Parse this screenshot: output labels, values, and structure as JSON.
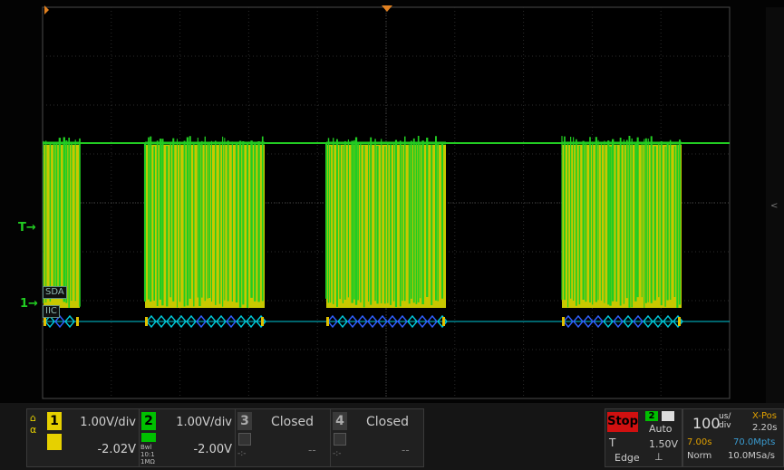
{
  "scope": {
    "markers": {
      "trigger_level_label": "T",
      "channel1_ground_label": "1"
    },
    "decode_labels": {
      "sda": "SDA",
      "protocol": "IIC"
    },
    "colors": {
      "ch1": "#c8c800",
      "ch2": "#22cc22",
      "decode": "#00c8d8",
      "grid": "#2b2b2b",
      "trigger": "#e08020"
    }
  },
  "channels": [
    {
      "number": "1",
      "scale": "1.00V/div",
      "offset": "-2.02V",
      "color": "#e6d000"
    },
    {
      "number": "2",
      "scale": "1.00V/div",
      "offset": "-2.00V",
      "color": "#00d000",
      "info": [
        "Bwl",
        "10:1",
        "1MΩ"
      ]
    },
    {
      "number": "3",
      "status": "Closed",
      "offset": "--",
      "sub": "-:-"
    },
    {
      "number": "4",
      "status": "Closed",
      "offset": "--",
      "sub": "-:-"
    }
  ],
  "status_panel": {
    "run_state": "Stop",
    "trigger_source": "2",
    "trigger_mode": "Auto",
    "trigger_label": "T",
    "trigger_level": "1.50V",
    "trigger_type": "Edge"
  },
  "timebase": {
    "scale_value": "100",
    "scale_unit_top": "us/",
    "scale_unit_bottom": "div",
    "xpos_label": "X-Pos",
    "xpos_value": "2.20s",
    "delay": "7.00s",
    "memory_depth": "70.0Mpts",
    "acq_mode": "Norm",
    "sample_rate": "10.0MSa/s"
  }
}
